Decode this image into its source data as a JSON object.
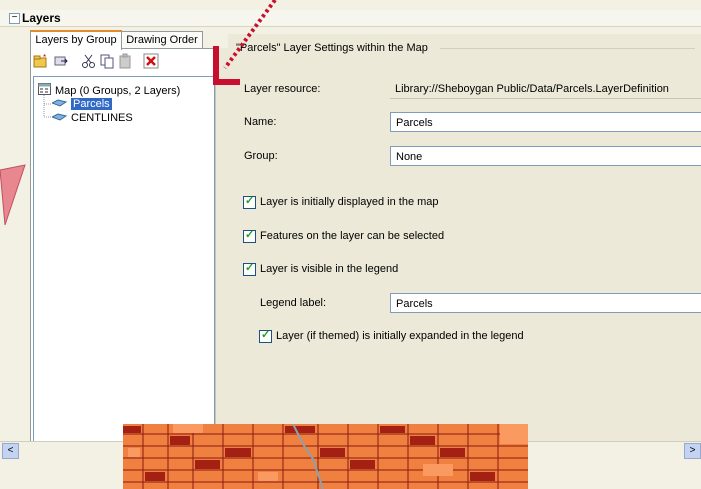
{
  "panel": {
    "title": "Layers",
    "collapse_glyph": "−"
  },
  "tabs": {
    "layers_by_group": "Layers by Group",
    "drawing_order": "Drawing Order"
  },
  "toolbar": {
    "icons": [
      "new-group-icon",
      "move-icon",
      "cut-icon",
      "copy-icon",
      "paste-icon",
      "delete-icon"
    ]
  },
  "tree": {
    "map": "Map (0 Groups, 2 Layers)",
    "layers": [
      "Parcels",
      "CENTLINES"
    ]
  },
  "settings": {
    "group_title": "\"Parcels\" Layer Settings within the Map",
    "layer_resource_label": "Layer resource:",
    "layer_resource_value": "Library://Sheboygan Public/Data/Parcels.LayerDefinition",
    "name_label": "Name:",
    "name_value": "Parcels",
    "group_label": "Group:",
    "group_value": "None",
    "cb_displayed": "Layer is initially displayed in the map",
    "cb_selectable": "Features on the layer can be selected",
    "cb_legend": "Layer is visible in the legend",
    "legend_label_label": "Legend label:",
    "legend_label_value": "Parcels",
    "cb_expanded": "Layer (if themed) is initially expanded in the legend"
  },
  "scrollbar": {
    "left_glyph": "<",
    "right_glyph": ">"
  },
  "colors": {
    "accent_tab": "#e68b2c",
    "selection": "#316ac5",
    "annotation_arrow": "#c8102e",
    "map_fill": "#f08040",
    "map_lines": "#8a1a10"
  }
}
